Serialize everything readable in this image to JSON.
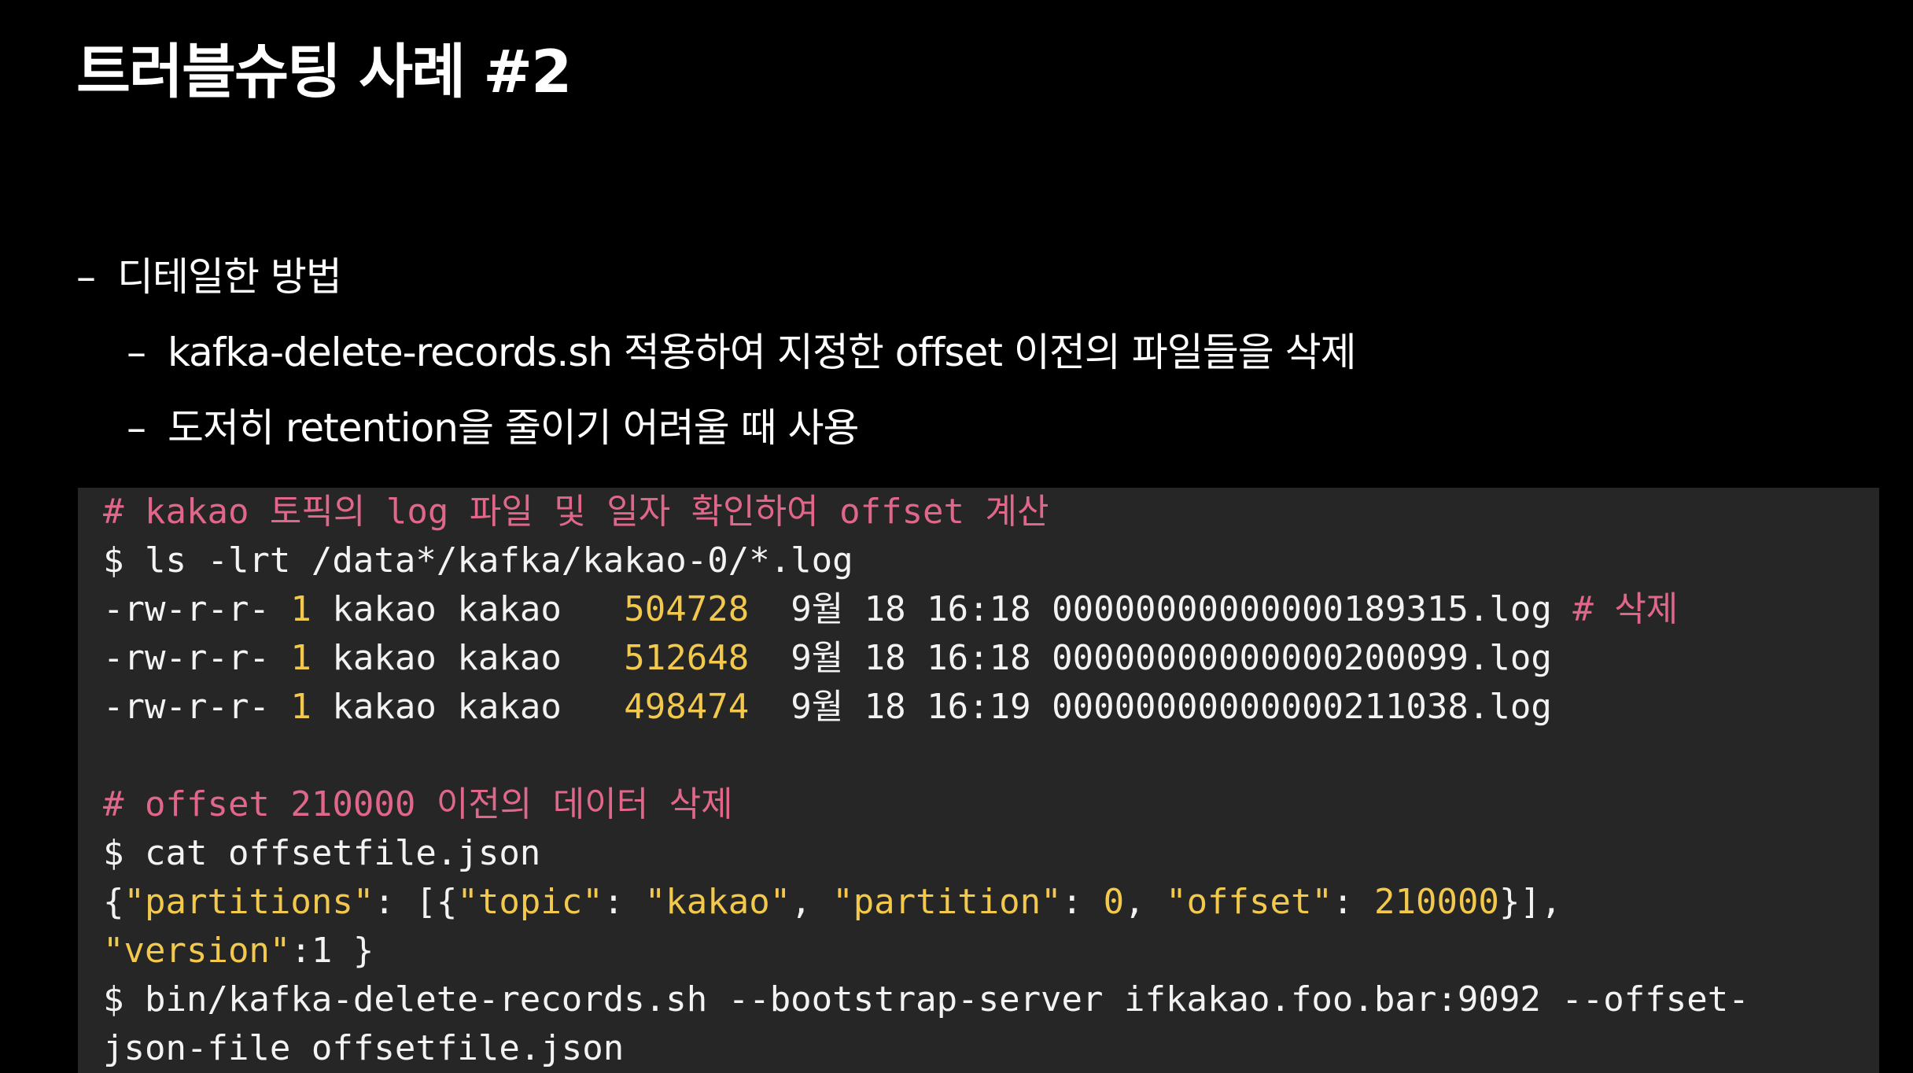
{
  "slide": {
    "title": "트러블슈팅 사례 #2",
    "bullets": {
      "level1": {
        "dash": "–",
        "text": "디테일한 방법"
      },
      "items": [
        {
          "dash": "–",
          "text": "kafka-delete-records.sh 적용하여 지정한 offset 이전의 파일들을 삭제"
        },
        {
          "dash": "–",
          "text": "도저히 retention을 줄이기 어려울 때 사용"
        }
      ]
    }
  },
  "code": {
    "comment1": "# kakao 토픽의 log 파일 및 일자 확인하여 offset 계산",
    "cmd_ls": "$ ls -lrt /data*/kafka/kakao-0/*.log",
    "files": [
      {
        "perm": "-rw-r-r- ",
        "links": "1",
        "owner": " kakao kakao   ",
        "size": "504728",
        "date": "  9월 18 16:18 ",
        "name": "00000000000000189315.log",
        "comment": " # 삭제"
      },
      {
        "perm": "-rw-r-r- ",
        "links": "1",
        "owner": " kakao kakao   ",
        "size": "512648",
        "date": "  9월 18 16:18 ",
        "name": "00000000000000200099.log",
        "comment": ""
      },
      {
        "perm": "-rw-r-r- ",
        "links": "1",
        "owner": " kakao kakao   ",
        "size": "498474",
        "date": "  9월 18 16:19 ",
        "name": "00000000000000211038.log",
        "comment": ""
      }
    ],
    "comment2": "# offset 210000 이전의 데이터 삭제",
    "cmd_cat": "$ cat offsetfile.json",
    "json": {
      "open": "{",
      "k_partitions": "\"partitions\"",
      "sep1": ": [{",
      "k_topic": "\"topic\"",
      "sep2": ": ",
      "v_topic": "\"kakao\"",
      "sep3": ", ",
      "k_partition": "\"partition\"",
      "sep4": ": ",
      "v_partition": "0",
      "sep5": ", ",
      "k_offset": "\"offset\"",
      "sep6": ": ",
      "v_offset": "210000",
      "close1": "}],",
      "k_version": "\"version\"",
      "v_version": ":1 }"
    },
    "cmd_delete_1": "$ bin/kafka-delete-records.sh --bootstrap-server ifkakao.foo.bar:9092 --offset-",
    "cmd_delete_2": "json-file offsetfile.json"
  }
}
